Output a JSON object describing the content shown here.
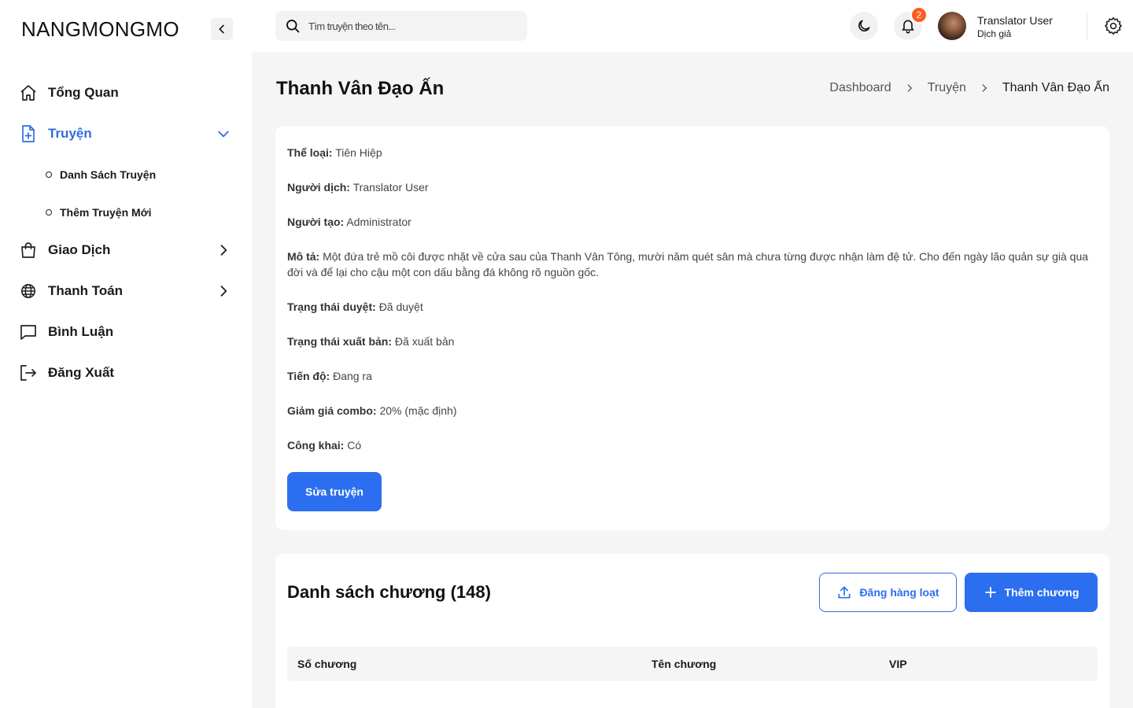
{
  "sidebar": {
    "logo": "NANGMONGMO",
    "items": [
      {
        "label": "Tổng Quan",
        "icon": "home-icon"
      },
      {
        "label": "Truyện",
        "icon": "file-plus-icon",
        "active": true
      },
      {
        "label": "Giao Dịch",
        "icon": "shopping-bag-icon"
      },
      {
        "label": "Thanh Toán",
        "icon": "globe-icon"
      },
      {
        "label": "Bình Luận",
        "icon": "message-icon"
      },
      {
        "label": "Đăng Xuất",
        "icon": "logout-icon"
      }
    ],
    "sub_items": [
      {
        "label": "Danh Sách Truyện"
      },
      {
        "label": "Thêm Truyện Mới"
      }
    ]
  },
  "header": {
    "search_placeholder": "Tìm truyện theo tên...",
    "notification_count": "2",
    "user_name": "Translator User",
    "user_role": "Dịch giả"
  },
  "page": {
    "title": "Thanh Vân Đạo Ấn",
    "breadcrumb": [
      "Dashboard",
      "Truyện",
      "Thanh Vân Đạo Ấn"
    ]
  },
  "story": {
    "genre_label": "Thể loại:",
    "genre": "Tiên Hiệp",
    "translator_label": "Người dịch:",
    "translator": "Translator User",
    "creator_label": "Người tạo:",
    "creator": "Administrator",
    "description_label": "Mô tả:",
    "description": "Một đứa trẻ mồ côi được nhặt về cửa sau của Thanh Vân Tông, mười năm quét sân mà chưa từng được nhận làm đệ tử. Cho đến ngày lão quản sự già qua đời và để lại cho cậu một con dấu bằng đá không rõ nguồn gốc.",
    "review_status_label": "Trạng thái duyệt:",
    "review_status": "Đã duyệt",
    "publish_status_label": "Trạng thái xuất bản:",
    "publish_status": "Đã xuất bản",
    "progress_label": "Tiến độ:",
    "progress": "Đang ra",
    "combo_discount_label": "Giảm giá combo:",
    "combo_discount": "20% (mặc định)",
    "public_label": "Công khai:",
    "public": "Có",
    "edit_button": "Sửa truyện"
  },
  "chapters": {
    "title": "Danh sách chương (148)",
    "bulk_upload_button": "Đăng hàng loạt",
    "add_button": "Thêm chương",
    "columns": [
      "Số chương",
      "Tên chương",
      "VIP"
    ]
  },
  "colors": {
    "accent": "#2b6ff0",
    "badge": "#ff5a1f",
    "active_nav": "#2f6de0"
  }
}
